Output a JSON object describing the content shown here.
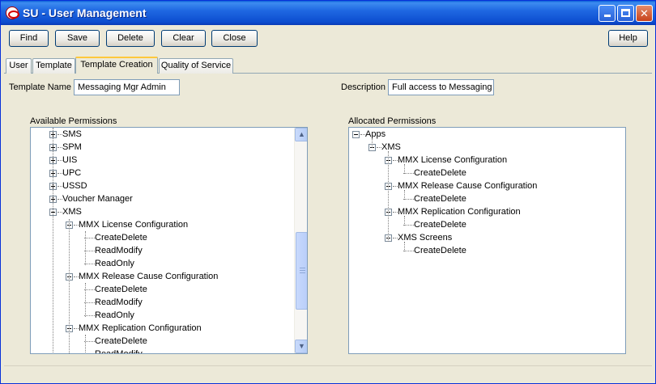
{
  "window": {
    "title": "SU - User Management"
  },
  "toolbar": {
    "find": "Find",
    "save": "Save",
    "delete": "Delete",
    "clear": "Clear",
    "close": "Close",
    "help": "Help"
  },
  "tabs": [
    {
      "label": "User"
    },
    {
      "label": "Template"
    },
    {
      "label": "Template Creation"
    },
    {
      "label": "Quality of Service"
    }
  ],
  "form": {
    "template_name_label": "Template Name",
    "template_name_value": "Messaging Mgr Admin",
    "description_label": "Description",
    "description_value": "Full access to Messaging"
  },
  "available": {
    "label": "Available Permissions",
    "rows": [
      {
        "label": "SMS",
        "state": "collapsed"
      },
      {
        "label": "SPM",
        "state": "collapsed"
      },
      {
        "label": "UIS",
        "state": "collapsed"
      },
      {
        "label": "UPC",
        "state": "collapsed"
      },
      {
        "label": "USSD",
        "state": "collapsed"
      },
      {
        "label": "Voucher Manager",
        "state": "collapsed"
      },
      {
        "label": "XMS",
        "state": "expanded"
      },
      {
        "label": "MMX License Configuration",
        "state": "expanded"
      },
      {
        "label": "CreateDelete",
        "state": "leaf"
      },
      {
        "label": "ReadModify",
        "state": "leaf"
      },
      {
        "label": "ReadOnly",
        "state": "leaf"
      },
      {
        "label": "MMX Release Cause Configuration",
        "state": "expanded"
      },
      {
        "label": "CreateDelete",
        "state": "leaf"
      },
      {
        "label": "ReadModify",
        "state": "leaf"
      },
      {
        "label": "ReadOnly",
        "state": "leaf"
      },
      {
        "label": "MMX Replication Configuration",
        "state": "expanded"
      },
      {
        "label": "CreateDelete",
        "state": "leaf"
      },
      {
        "label": "ReadModify",
        "state": "leaf"
      }
    ]
  },
  "allocated": {
    "label": "Allocated Permissions",
    "rows": [
      {
        "label": "Apps",
        "state": "expanded"
      },
      {
        "label": "XMS",
        "state": "expanded"
      },
      {
        "label": "MMX License Configuration",
        "state": "expanded"
      },
      {
        "label": "CreateDelete",
        "state": "leaf"
      },
      {
        "label": "MMX Release Cause Configuration",
        "state": "expanded"
      },
      {
        "label": "CreateDelete",
        "state": "leaf"
      },
      {
        "label": "MMX Replication Configuration",
        "state": "expanded"
      },
      {
        "label": "CreateDelete",
        "state": "leaf"
      },
      {
        "label": "XMS Screens",
        "state": "expanded"
      },
      {
        "label": "CreateDelete",
        "state": "leaf"
      }
    ]
  },
  "icons": {
    "app": "oracle-icon",
    "minimize": "minimize-icon",
    "maximize": "maximize-icon",
    "close": "close-icon",
    "scroll_up": "chevron-up-icon",
    "scroll_down": "chevron-down-icon"
  }
}
